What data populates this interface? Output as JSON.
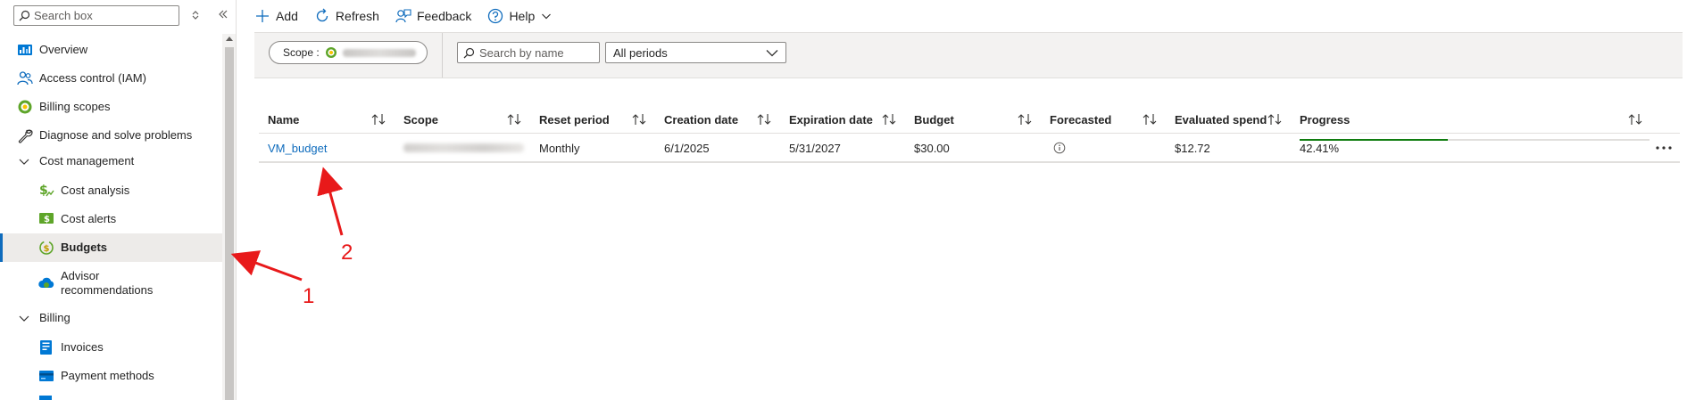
{
  "sidebar": {
    "search_placeholder": "Search box",
    "items": [
      {
        "label": "Overview",
        "icon": "overview-icon",
        "level": 0
      },
      {
        "label": "Access control (IAM)",
        "icon": "people-icon",
        "level": 0
      },
      {
        "label": "Billing scopes",
        "icon": "billing-scope-icon",
        "level": 0
      },
      {
        "label": "Diagnose and solve problems",
        "icon": "wrench-icon",
        "level": 0
      },
      {
        "label": "Cost management",
        "icon": "chevron-down-icon",
        "level": 0,
        "group": true
      },
      {
        "label": "Cost analysis",
        "icon": "cost-analysis-icon",
        "level": 1
      },
      {
        "label": "Cost alerts",
        "icon": "cost-alerts-icon",
        "level": 1
      },
      {
        "label": "Budgets",
        "icon": "budgets-icon",
        "level": 1,
        "selected": true
      },
      {
        "label": "Advisor recommendations",
        "icon": "advisor-icon",
        "level": 1
      },
      {
        "label": "Billing",
        "icon": "chevron-down-icon",
        "level": 0,
        "group": true
      },
      {
        "label": "Invoices",
        "icon": "invoice-icon",
        "level": 1
      },
      {
        "label": "Payment methods",
        "icon": "payment-icon",
        "level": 1
      }
    ]
  },
  "toolbar": {
    "add": "Add",
    "refresh": "Refresh",
    "feedback": "Feedback",
    "help": "Help"
  },
  "filters": {
    "scope_label": "Scope :",
    "search_placeholder": "Search by name",
    "period_value": "All periods"
  },
  "table": {
    "columns": [
      "Name",
      "Scope",
      "Reset period",
      "Creation date",
      "Expiration date",
      "Budget",
      "Forecasted",
      "Evaluated spend",
      "Progress"
    ],
    "rows": [
      {
        "name": "VM_budget",
        "reset_period": "Monthly",
        "creation_date": "6/1/2025",
        "expiration_date": "5/31/2027",
        "budget": "$30.00",
        "evaluated_spend": "$12.72",
        "progress": "42.41%",
        "progress_value": 0.4241
      }
    ]
  },
  "annotations": {
    "label_1": "1",
    "label_2": "2",
    "color": "#e8191a"
  },
  "colors": {
    "accent": "#0f6cbd",
    "progress": "#107c10",
    "selected_bg": "#edebe9"
  }
}
